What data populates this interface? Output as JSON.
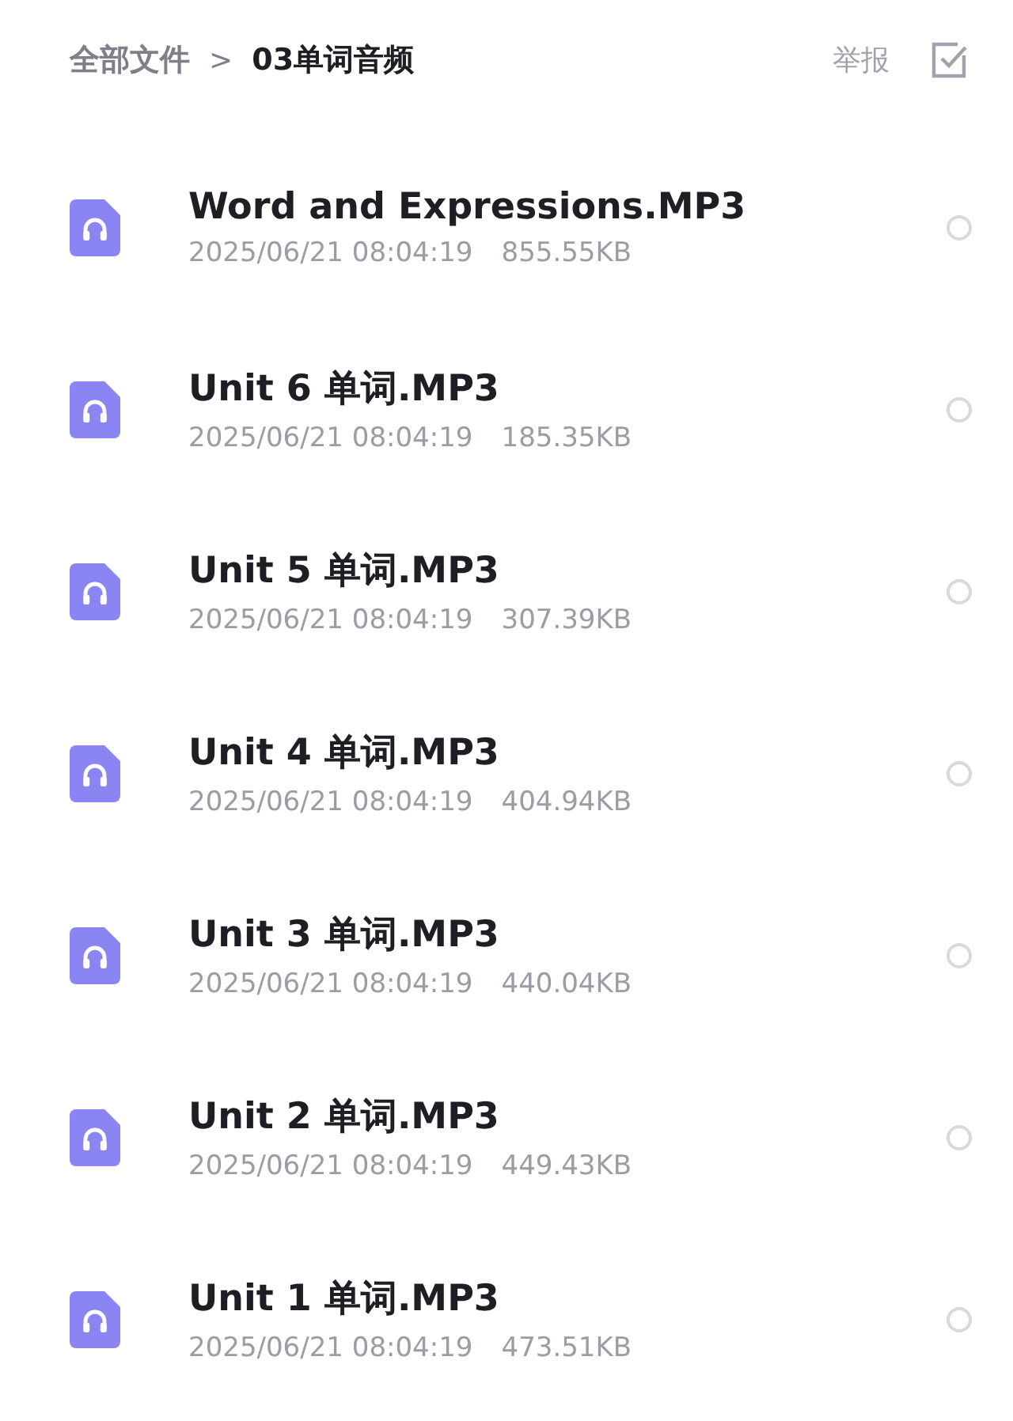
{
  "breadcrumb": {
    "root": "全部文件",
    "separator": ">",
    "current": "03单词音频"
  },
  "actions": {
    "report": "举报"
  },
  "files": [
    {
      "name": "Word and Expressions.MP3",
      "date": "2025/06/21 08:04:19",
      "size": "855.55KB",
      "selected": false
    },
    {
      "name": "Unit 6 单词.MP3",
      "date": "2025/06/21 08:04:19",
      "size": "185.35KB",
      "selected": false
    },
    {
      "name": "Unit 5 单词.MP3",
      "date": "2025/06/21 08:04:19",
      "size": "307.39KB",
      "selected": false
    },
    {
      "name": "Unit 4 单词.MP3",
      "date": "2025/06/21 08:04:19",
      "size": "404.94KB",
      "selected": false
    },
    {
      "name": "Unit 3 单词.MP3",
      "date": "2025/06/21 08:04:19",
      "size": "440.04KB",
      "selected": false
    },
    {
      "name": "Unit 2 单词.MP3",
      "date": "2025/06/21 08:04:19",
      "size": "449.43KB",
      "selected": false
    },
    {
      "name": "Unit 1 单词.MP3",
      "date": "2025/06/21 08:04:19",
      "size": "473.51KB",
      "selected": false
    }
  ]
}
